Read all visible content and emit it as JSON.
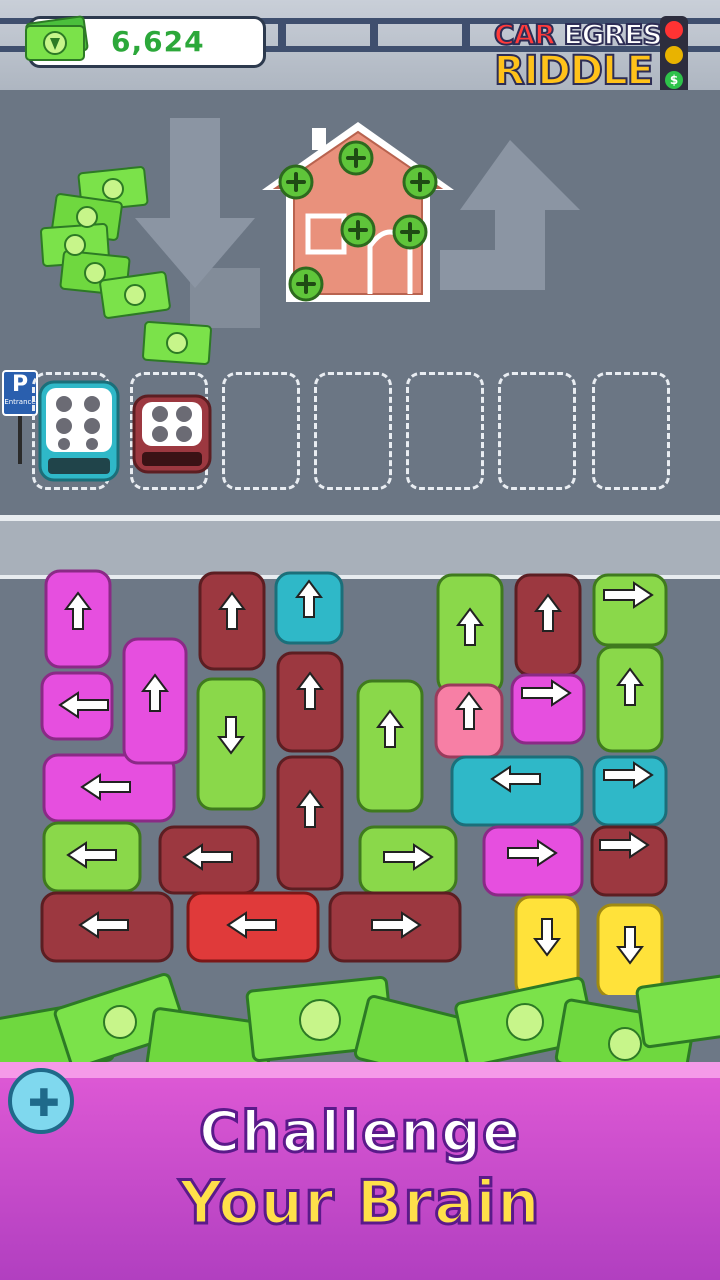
{
  "header": {
    "coin_balance": "6,624",
    "logo": {
      "word1": "CAR",
      "word2": "EGRESS",
      "word3": "RIDDLE"
    },
    "traffic_light_symbol": "$"
  },
  "lot": {
    "parking_sign": {
      "letter": "P",
      "text": "Entrance"
    },
    "house_screws": 6,
    "slots_total": 7,
    "slots_filled": 2,
    "parked": [
      {
        "color": "#2fb8c8",
        "seats": "4-hole seat pattern"
      },
      {
        "color": "#9c3840",
        "seats": "4-hole seat pattern"
      }
    ]
  },
  "puzzle": {
    "vehicle_colors": {
      "magenta": "#e64fdf",
      "maroon": "#9c3840",
      "cyan": "#2fb8c8",
      "green": "#8ad84a",
      "pink": "#f77fa5",
      "red": "#e03a3a",
      "yellow": "#ffe23a"
    }
  },
  "banner": {
    "line1": "Challenge",
    "line2": "Your Brain"
  },
  "colors": {
    "accent_green": "#2ca83a",
    "logo_yellow": "#ffc21a",
    "banner_magenta": "#c64ccc",
    "headline_yellow": "#ffe04a"
  }
}
